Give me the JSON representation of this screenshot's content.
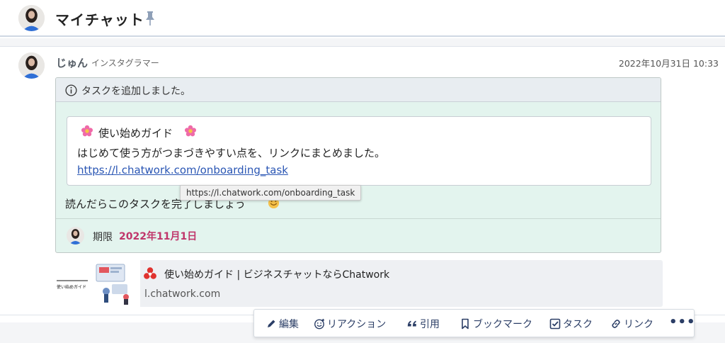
{
  "header": {
    "title": "マイチャット",
    "icons": {
      "avatar": "user-avatar",
      "pin": "pin-icon"
    }
  },
  "message": {
    "sender": "じゅん",
    "role": "インスタグラマー",
    "timestamp": "2022年10月31日 10:33",
    "task": {
      "header_text": "タスクを追加しました。",
      "quote": {
        "title": "使い始めガイド",
        "description": "はじめて使う方がつまづきやすい点を、リンクにまとめました。",
        "link": "https://l.chatwork.com/onboarding_task"
      },
      "body": "読んだらこのタスクを完了しましょう",
      "deadline_label": "期限",
      "deadline_date": "2022年11月1日"
    },
    "tooltip": "https://l.chatwork.com/onboarding_task",
    "preview": {
      "title": "使い始めガイド | ビジネスチャットならChatwork",
      "domain": "l.chatwork.com",
      "thumb_caption": "使い始めガイド"
    }
  },
  "actions": {
    "edit": "編集",
    "reaction": "リアクション",
    "quote": "引用",
    "bookmark": "ブックマーク",
    "task": "タスク",
    "link": "リンク",
    "more": "•••"
  },
  "colors": {
    "task_bg": "#e3f4ee",
    "deadline": "#c0356a",
    "link": "#2a56b4",
    "action_text": "#2b3e66"
  }
}
